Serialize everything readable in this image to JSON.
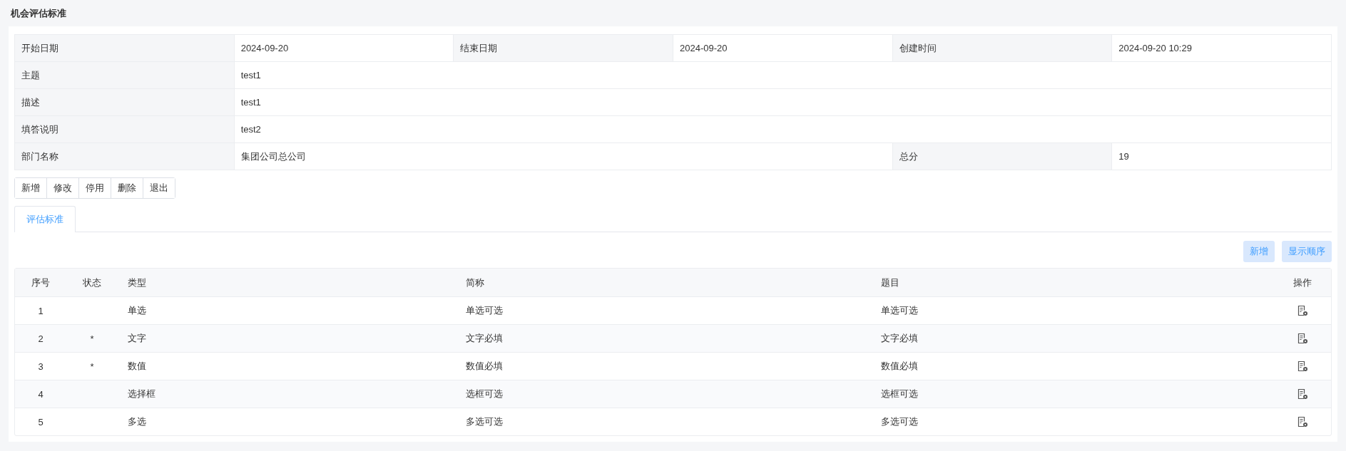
{
  "page_title": "机会评估标准",
  "info": {
    "start_label": "开始日期",
    "start_value": "2024-09-20",
    "end_label": "结束日期",
    "end_value": "2024-09-20",
    "created_label": "创建时间",
    "created_value": "2024-09-20 10:29",
    "rows": [
      {
        "label": "主题",
        "value": "test1"
      },
      {
        "label": "描述",
        "value": "test1"
      },
      {
        "label": "填答说明",
        "value": "test2"
      }
    ],
    "dept_label": "部门名称",
    "dept_value": "集团公司总公司",
    "score_label": "总分",
    "score_value": "19"
  },
  "actions": [
    "新增",
    "修改",
    "停用",
    "删除",
    "退出"
  ],
  "tabs": [
    {
      "label": "评估标准",
      "selected": true
    }
  ],
  "table_buttons": [
    "新增",
    "显示顺序"
  ],
  "table": {
    "columns": [
      "序号",
      "状态",
      "类型",
      "简称",
      "题目",
      "操作"
    ],
    "rows": [
      {
        "no": "1",
        "type": "单选",
        "short": "单选可选",
        "title": "单选可选"
      },
      {
        "no": "2",
        "status": "*",
        "type": "文字",
        "short": "文字必填",
        "title": "文字必填"
      },
      {
        "no": "3",
        "status": "*",
        "type": "数值",
        "short": "数值必填",
        "title": "数值必填"
      },
      {
        "no": "4",
        "type": "选择框",
        "short": "选框可选",
        "title": "选框可选"
      },
      {
        "no": "5",
        "type": "多选",
        "short": "多选可选",
        "title": "多选可选"
      }
    ]
  }
}
